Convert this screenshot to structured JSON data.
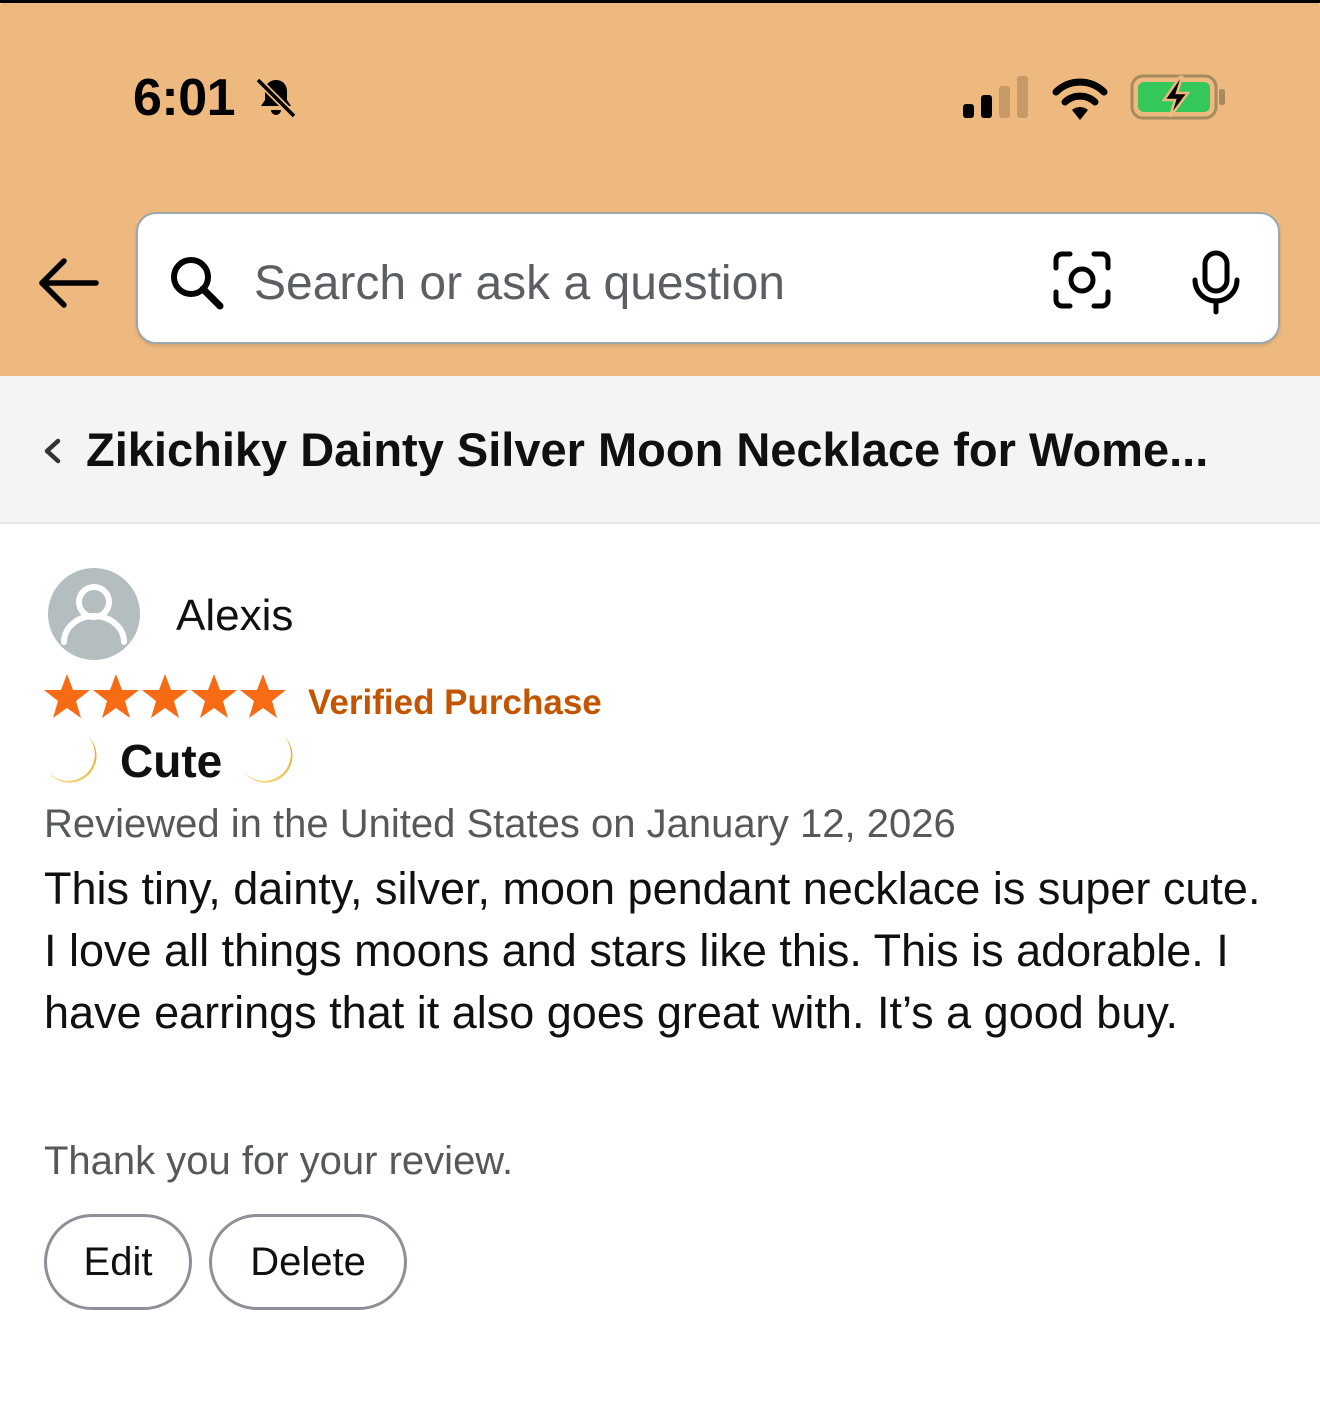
{
  "status_bar": {
    "time": "6:01",
    "icons": [
      "bell-slash-icon",
      "cellular-signal-icon",
      "wifi-icon",
      "battery-charging-icon"
    ],
    "battery_color": "#34c759"
  },
  "header": {
    "background_color": "#edb97f",
    "back_icon": "arrow-left-icon",
    "search": {
      "placeholder": "Search or ask a question",
      "icons": [
        "search-icon",
        "camera-lens-icon",
        "microphone-icon"
      ]
    }
  },
  "product_bar": {
    "back_icon": "chevron-left-icon",
    "title": "Zikichiky Dainty Silver Moon Necklace for Wome..."
  },
  "review": {
    "reviewer_name": "Alexis",
    "avatar_icon": "user-silhouette-icon",
    "rating": 5,
    "rating_max": 5,
    "star_color": "#f76b15",
    "badge": "Verified Purchase",
    "badge_color": "#c45500",
    "title_emoji": "🌙",
    "title": "Cute",
    "meta": "Reviewed in the United States on January 12, 2026",
    "body": "This tiny, dainty, silver, moon pendant necklace is super cute. I love all things moons and stars like this. This is adorable. I have earrings that it also goes great with. It’s a good buy.",
    "thanks": "Thank you for your review.",
    "actions": {
      "edit_label": "Edit",
      "delete_label": "Delete"
    }
  }
}
